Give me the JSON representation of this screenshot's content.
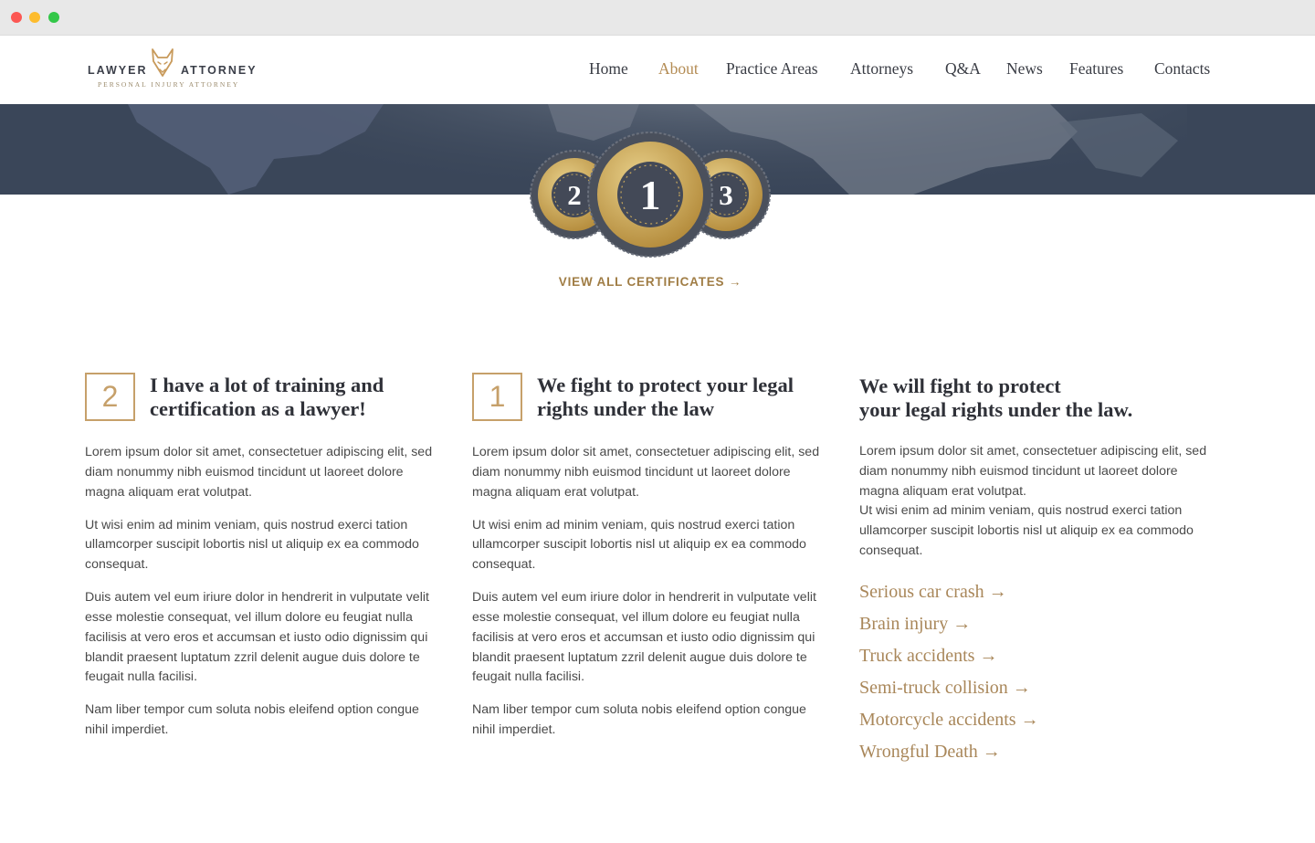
{
  "header": {
    "logo_word_left": "LAWYER",
    "logo_word_right": "ATTORNEY",
    "logo_tagline": "PERSONAL INJURY ATTORNEY"
  },
  "nav": {
    "items": [
      {
        "label": "Home"
      },
      {
        "label": "About"
      },
      {
        "label": "Practice Areas"
      },
      {
        "label": "Attorneys"
      },
      {
        "label": "Q&A"
      },
      {
        "label": "News"
      },
      {
        "label": "Features"
      },
      {
        "label": "Contacts"
      }
    ],
    "active": "About"
  },
  "certificates": {
    "medals": [
      "2",
      "1",
      "3"
    ],
    "link_label": "VIEW ALL CERTIFICATES →"
  },
  "columns": [
    {
      "number": "2",
      "heading_line1": "I have a lot of training and",
      "heading_line2": "certification as a lawyer!",
      "paragraphs": [
        "Lorem ipsum dolor sit amet, consectetuer adipiscing elit, sed diam nonummy nibh euismod tincidunt ut laoreet dolore magna aliquam erat volutpat.",
        "Ut wisi enim ad minim veniam, quis nostrud exerci tation ullamcorper suscipit lobortis nisl ut aliquip ex ea commodo consequat.",
        "Duis autem vel eum iriure dolor in hendrerit in vulputate velit esse molestie consequat, vel illum dolore eu feugiat nulla facilisis at vero eros et accumsan et iusto odio dignissim qui blandit praesent luptatum zzril delenit augue duis dolore te feugait nulla facilisi.",
        "Nam liber tempor cum soluta nobis eleifend option congue nihil imperdiet."
      ]
    },
    {
      "number": "1",
      "heading_line1": "We fight to protect your legal",
      "heading_line2": "rights under the law",
      "paragraphs": [
        "Lorem ipsum dolor sit amet, consectetuer adipiscing elit, sed diam nonummy nibh euismod tincidunt ut laoreet dolore magna aliquam erat volutpat.",
        "Ut wisi enim ad minim veniam, quis nostrud exerci tation ullamcorper suscipit lobortis nisl ut aliquip ex ea commodo consequat.",
        "Duis autem vel eum iriure dolor in hendrerit in vulputate velit esse molestie consequat, vel illum dolore eu feugiat nulla facilisis at vero eros et accumsan et iusto odio dignissim qui blandit praesent luptatum zzril delenit augue duis dolore te feugait nulla facilisi.",
        "Nam liber tempor cum soluta nobis eleifend option congue nihil imperdiet."
      ]
    },
    {
      "heading_line1": "We will fight to protect",
      "heading_line2": "your legal rights under the law.",
      "paragraphs": [
        "Lorem ipsum dolor sit amet, consectetuer adipiscing elit, sed diam nonummy nibh euismod tincidunt ut laoreet dolore magna aliquam erat volutpat.",
        "Ut wisi enim ad minim veniam, quis nostrud exerci tation ullamcorper suscipit lobortis nisl ut aliquip ex ea commodo consequat."
      ],
      "links": [
        "Serious car crash →",
        "Brain injury →",
        "Truck accidents →",
        "Semi-truck collision →",
        "Motorcycle accidents →",
        "Wrongful Death →"
      ]
    }
  ],
  "colors": {
    "accent_gold": "#b38b53",
    "banner_navy": "#3a4659",
    "heading_dark": "#2f3138"
  }
}
